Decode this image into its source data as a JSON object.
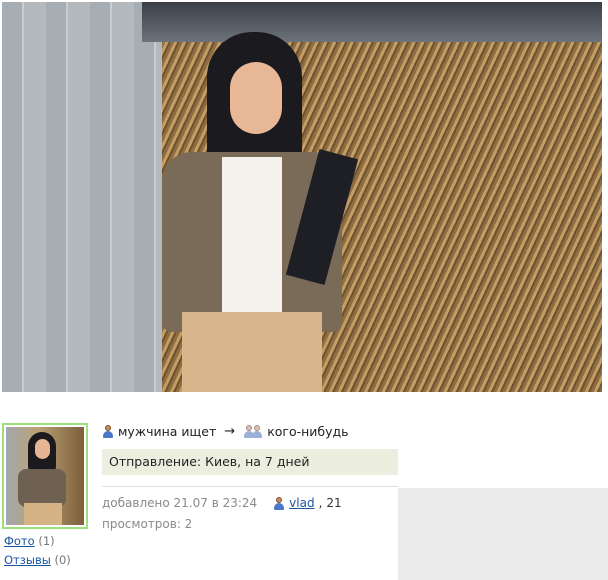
{
  "listing": {
    "seeker": "мужчина ищет",
    "target": "кого-нибудь",
    "arrow": "→",
    "destination": "Отправление: Киев, на 7 дней",
    "added": "добавлено 21.07 в 23:24",
    "username": "vlad",
    "age_sep": ",",
    "age": "21",
    "views": "просмотров: 2"
  },
  "sidebar": {
    "photo_label": "Фото",
    "photo_count": "(1)",
    "reviews_label": "Отзывы",
    "reviews_count": "(0)"
  },
  "icons": {
    "seeker": "male-person-icon",
    "target": "couple-icon",
    "user": "male-person-icon"
  }
}
